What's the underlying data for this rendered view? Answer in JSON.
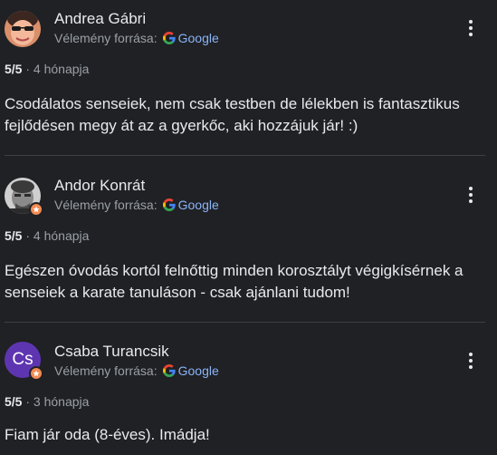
{
  "source_label": "Vélemény forrása:",
  "source_name": "Google",
  "reviews": [
    {
      "author": "Andrea Gábri",
      "rating": "5/5",
      "age": "4 hónapja",
      "text": "Csodálatos senseiek, nem csak testben de lélekben is fantasztikus fejlődésen megy át az a gyerkőc, aki hozzájuk jár! :)",
      "avatar": "photo",
      "local_guide": false
    },
    {
      "author": "Andor Konrát",
      "rating": "5/5",
      "age": "4 hónapja",
      "text": "Egészen óvodás kortól felnőttig minden korosztályt végigkísérnek a senseiek a karate tanuláson - csak ajánlani tudom!",
      "avatar": "photo",
      "local_guide": true
    },
    {
      "author": "Csaba Turancsik",
      "rating": "5/5",
      "age": "3 hónapja",
      "text": "Fiam jár oda (8-éves). Imádja!",
      "avatar": "initials",
      "initials": "Cs",
      "avatar_color": "#5e35b1",
      "local_guide": true
    }
  ],
  "colors": {
    "background": "#202124",
    "primary_text": "#e8eaed",
    "secondary_text": "#9aa0a6",
    "link": "#8ab4f8",
    "badge": "#f28b52"
  }
}
